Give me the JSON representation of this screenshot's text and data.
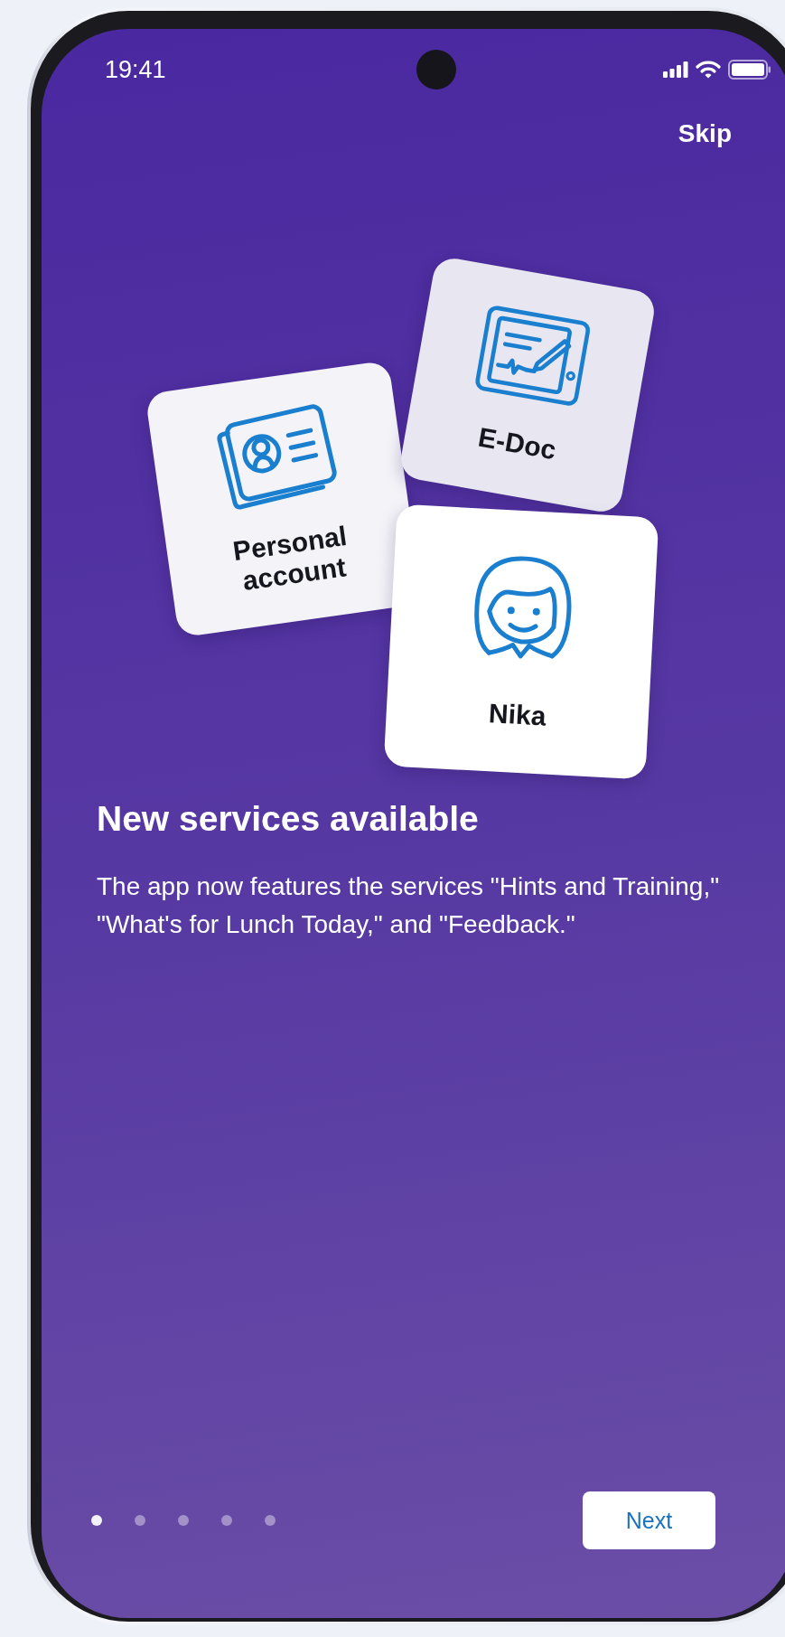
{
  "status_bar": {
    "time": "19:41"
  },
  "skip": "Skip",
  "cards": [
    {
      "label": "Personal account"
    },
    {
      "label": "E-Doc"
    },
    {
      "label": "Nika"
    }
  ],
  "title": "New services available",
  "description": "The app now features the services \"Hints and Training,\" \"What's for Lunch Today,\" and \"Feedback.\"",
  "pages": [
    {
      "selected": true
    },
    {
      "selected": false
    },
    {
      "selected": false
    },
    {
      "selected": false
    },
    {
      "selected": false
    }
  ],
  "next_button": "Next"
}
